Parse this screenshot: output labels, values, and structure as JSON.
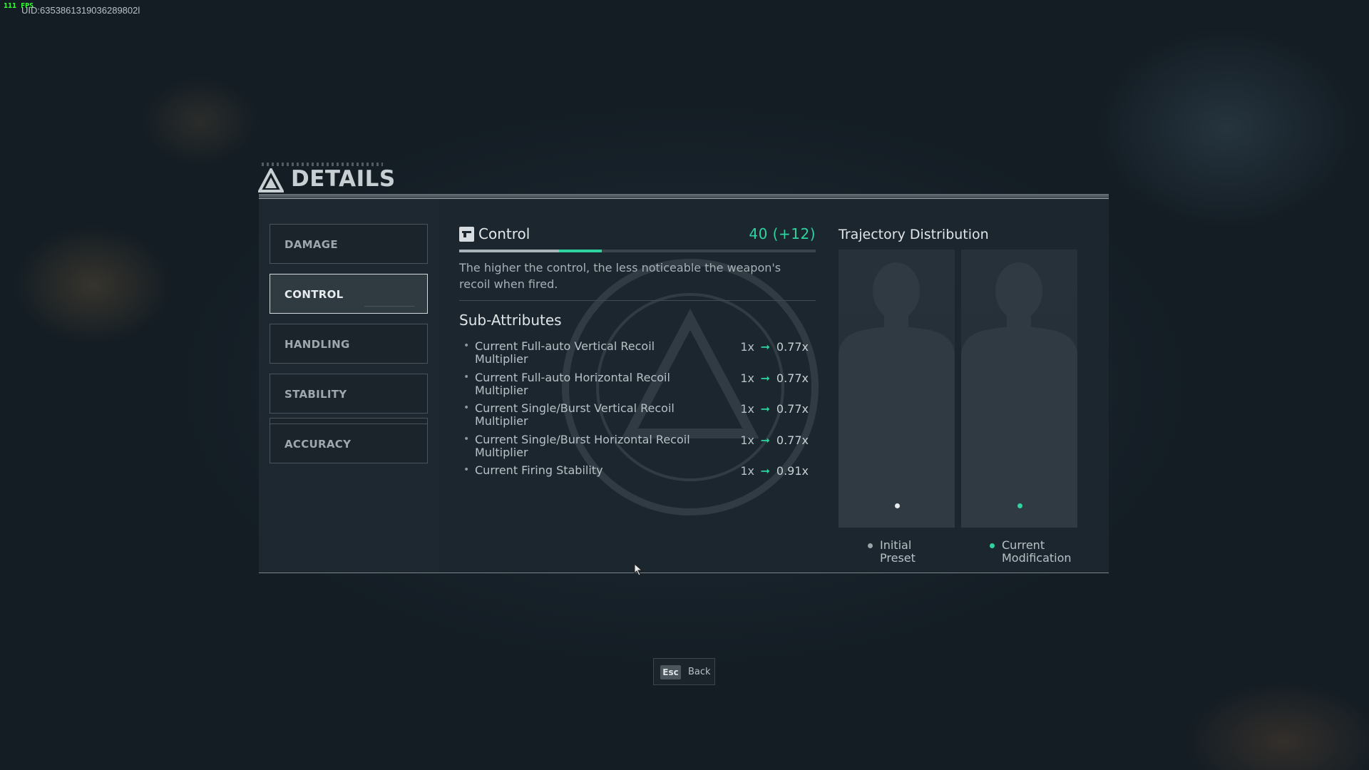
{
  "hud": {
    "fps": "111 FPS",
    "uid": "UID:6353861319036289802l"
  },
  "header": {
    "title": "DETAILS"
  },
  "tabs": [
    {
      "label": "DAMAGE",
      "active": false
    },
    {
      "label": "CONTROL",
      "active": true
    },
    {
      "label": "HANDLING",
      "active": false
    },
    {
      "label": "STABILITY",
      "active": false
    },
    {
      "label": "ACCURACY",
      "active": false
    }
  ],
  "stat": {
    "name": "Control",
    "value": "40 (+12)",
    "base_fraction": 0.28,
    "bonus_fraction": 0.12,
    "description": "The higher the control, the less noticeable the weapon's recoil when fired."
  },
  "sub_attributes": {
    "title": "Sub-Attributes",
    "items": [
      {
        "name": "Current Full-auto Vertical Recoil Multiplier",
        "from": "1x",
        "to": "0.77x"
      },
      {
        "name": "Current Full-auto Horizontal Recoil Multiplier",
        "from": "1x",
        "to": "0.77x"
      },
      {
        "name": "Current Single/Burst Vertical Recoil Multiplier",
        "from": "1x",
        "to": "0.77x"
      },
      {
        "name": "Current Single/Burst Horizontal Recoil Multiplier",
        "from": "1x",
        "to": "0.77x"
      },
      {
        "name": "Current Firing Stability",
        "from": "1x",
        "to": "0.91x"
      }
    ]
  },
  "trajectory": {
    "title": "Trajectory Distribution",
    "legend": [
      {
        "label": "Initial Preset",
        "color": "#9aa3a8"
      },
      {
        "label": "Current Modification",
        "color": "#2fd3a0"
      }
    ]
  },
  "footer": {
    "key": "Esc",
    "label": "Back"
  },
  "colors": {
    "accent": "#2fd3a0",
    "panel": "#1c262e"
  }
}
